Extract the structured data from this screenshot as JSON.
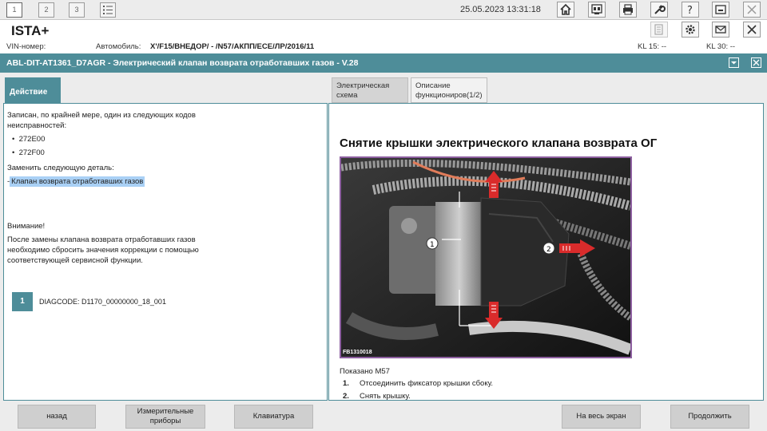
{
  "toolbar": {
    "tabs": [
      "1",
      "2",
      "3"
    ],
    "datetime": "25.05.2023 13:31:18"
  },
  "app": {
    "title": "ISTA+"
  },
  "vehicle": {
    "vin_label": "VIN-номер:",
    "car_label": "Автомобиль:",
    "car_value": "X'/F15/ВНЕДОР/ - /N57/АКПП/ЕСЕ/ЛР/2016/11",
    "kl15": "KL 15:  --",
    "kl30": "KL 30:  --"
  },
  "document": {
    "title": "ABL-DIT-AT1361_D7AGR - Электрический клапан возврата отработавших газов - V.28"
  },
  "tabs": {
    "action": "Действие",
    "circuit_line1": "Электрическая",
    "circuit_line2": "схема",
    "desc_line1": "Описание",
    "desc_line2": "функциониров(1/2)"
  },
  "left": {
    "intro_line1": "Записан, по крайней мере, один из следующих кодов",
    "intro_line2": "неисправностей:",
    "codes": [
      "272E00",
      "272F00"
    ],
    "replace_label": "Заменить следующую деталь:",
    "part_prefix": "-",
    "part": "Клапан возврата отработавших газов",
    "warning_label": "Внимание!",
    "warning_line1": "После замены клапана возврата отработавших газов",
    "warning_line2": "необходимо сбросить значения коррекции с помощью",
    "warning_line3": "соответствующей сервисной функции.",
    "step_number": "1",
    "diagcode": "DIAGCODE: D1170_00000000_18_001"
  },
  "right": {
    "title": "Снятие крышки электрического клапана возврата ОГ",
    "figure_code": "FB1310018",
    "callouts": [
      "1",
      "2"
    ],
    "caption": "Показано M57",
    "steps": [
      {
        "num": "1.",
        "text": "Отсоединить фиксатор крышки сбоку."
      },
      {
        "num": "2.",
        "text": "Снять крышку."
      }
    ]
  },
  "buttons": {
    "back": "назад",
    "measure_line1": "Измерительные",
    "measure_line2": "приборы",
    "keyboard": "Клавиатура",
    "fullscreen": "На весь экран",
    "continue": "Продолжить"
  },
  "colors": {
    "accent": "#4e8d99",
    "highlight": "#a9d0f5",
    "arrow": "#d92b2b"
  }
}
